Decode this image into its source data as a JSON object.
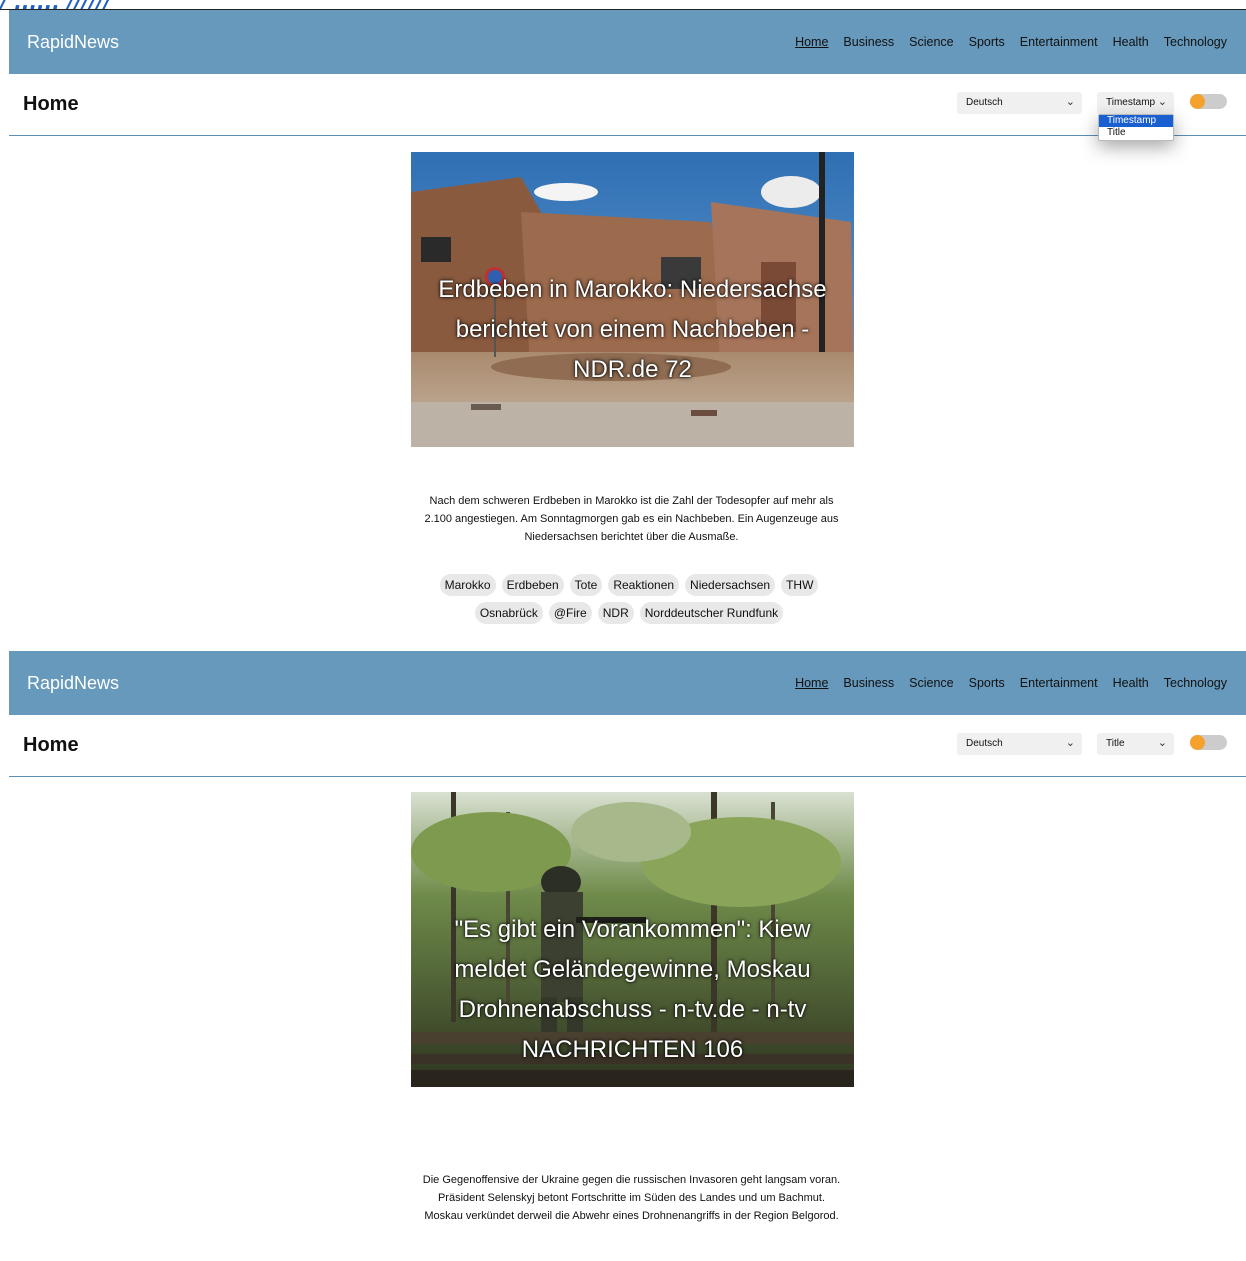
{
  "overlay_fragment": "/ ...... //////",
  "feed_copies": [
    {
      "navbar": {
        "brand": "RapidNews",
        "links": [
          "Home",
          "Business",
          "Science",
          "Sports",
          "Entertainment",
          "Health",
          "Technology"
        ],
        "active_link": "Home"
      },
      "header": {
        "title": "Home",
        "language_select": "Deutsch",
        "sort_select": "Timestamp",
        "sort_dropdown_open": true,
        "sort_options": [
          "Timestamp",
          "Title"
        ],
        "highlighted_option": "Timestamp"
      },
      "article": {
        "title": "Erdbeben in Marokko: Niedersachse berichtet von einem Nachbeben - NDR.de 72",
        "description": "Nach dem schweren Erdbeben in Marokko ist die Zahl der Todesopfer auf mehr als 2.100 angestiegen. Am Sonntagmorgen gab es ein Nachbeben. Ein Augenzeuge aus Niedersachsen berichtet über die Ausmaße.",
        "tags": [
          "Marokko",
          "Erdbeben",
          "Tote",
          "Reaktionen",
          "Niedersachsen",
          "THW",
          "Osnabrück",
          "@Fire",
          "NDR",
          "Norddeutscher Rundfunk"
        ]
      }
    },
    {
      "navbar": {
        "brand": "RapidNews",
        "links": [
          "Home",
          "Business",
          "Science",
          "Sports",
          "Entertainment",
          "Health",
          "Technology"
        ],
        "active_link": "Home"
      },
      "header": {
        "title": "Home",
        "language_select": "Deutsch",
        "sort_select": "Title",
        "sort_dropdown_open": false
      },
      "article": {
        "title": "\"Es gibt ein Vorankommen\": Kiew meldet Geländegewinne, Moskau Drohnenabschuss - n-tv.de - n-tv NACHRICHTEN 106",
        "description": "Die Gegenoffensive der Ukraine gegen die russischen Invasoren geht langsam voran. Präsident Selenskyj betont Fortschritte im Süden des Landes und um Bachmut. Moskau verkündet derweil die Abwehr eines Drohnenangriffs in der Region Belgorod."
      }
    }
  ],
  "colors": {
    "navbar_bg": "#6699bb",
    "brand_text": "#ffffff",
    "header_rule": "#5a8fb8",
    "toggle_knob": "#f4a22d",
    "toggle_track": "#cccccc",
    "option_highlight": "#1a5fd0",
    "tag_bg": "#e8e8e8"
  },
  "icons": {
    "select_arrow": "chevron-down-icon",
    "theme_toggle": "toggle-switch"
  }
}
